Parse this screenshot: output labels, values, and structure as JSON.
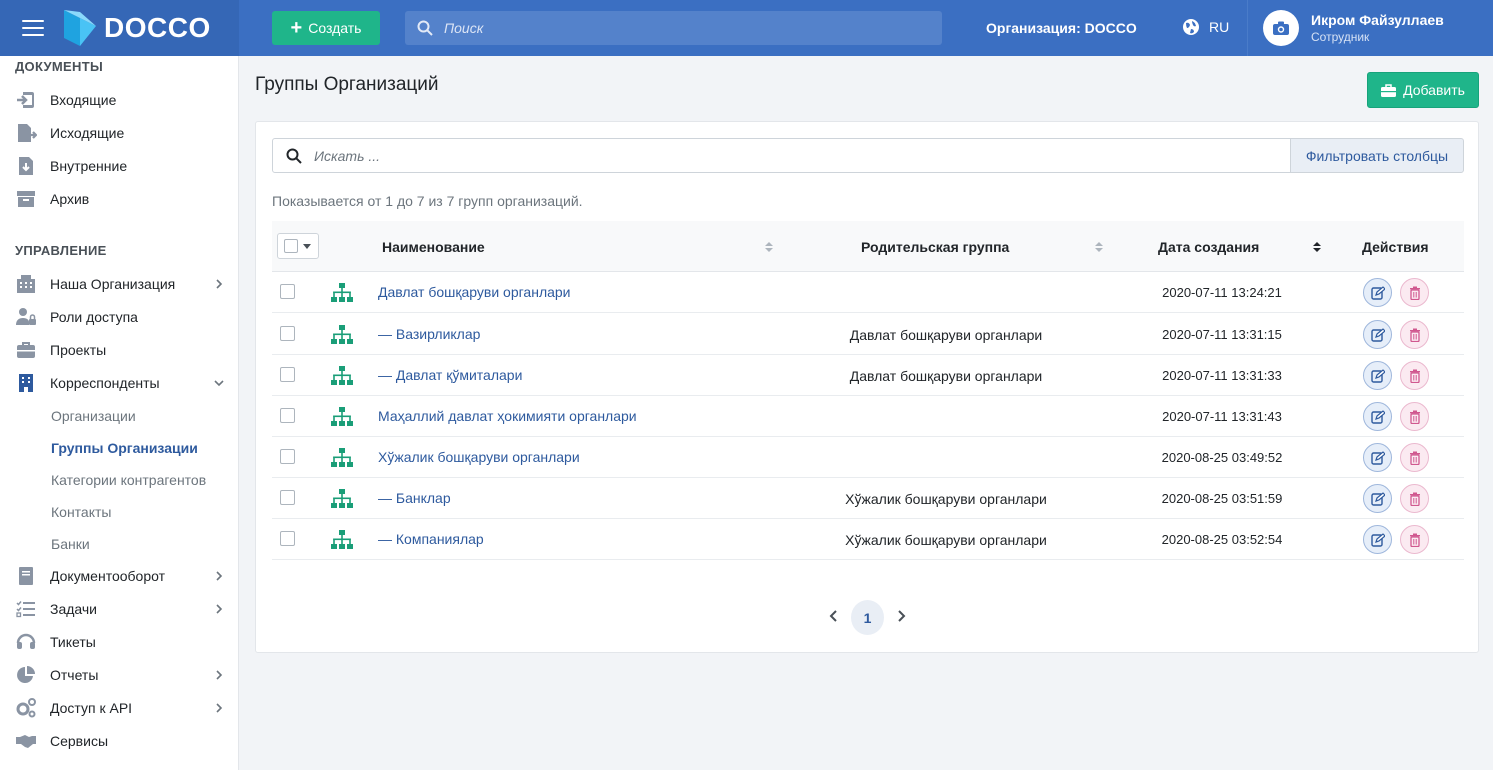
{
  "topbar": {
    "brand": "DOCCO",
    "create_label": "Создать",
    "search_placeholder": "Поиск",
    "org_label": "Организация: DOCCO",
    "lang": "RU",
    "user_name": "Икром Файзуллаев",
    "user_role": "Сотрудник"
  },
  "sidebar": {
    "section_docs": "ДОКУМЕНТЫ",
    "docs_items": [
      {
        "label": "Входящие",
        "icon": "inbox-in-icon"
      },
      {
        "label": "Исходящие",
        "icon": "file-out-icon"
      },
      {
        "label": "Внутренние",
        "icon": "file-download-icon"
      },
      {
        "label": "Архив",
        "icon": "archive-icon"
      }
    ],
    "section_manage": "УПРАВЛЕНИЕ",
    "manage_items": [
      {
        "label": "Наша Организация",
        "icon": "building-icon"
      },
      {
        "label": "Роли доступа",
        "icon": "users-lock-icon"
      },
      {
        "label": "Проекты",
        "icon": "briefcase-icon"
      },
      {
        "label": "Корреспонденты",
        "icon": "office-icon"
      }
    ],
    "sub_items": [
      "Организации",
      "Группы Организации",
      "Категории контрагентов",
      "Контакты",
      "Банки"
    ],
    "more_items": [
      {
        "label": "Документооборот",
        "icon": "book-icon"
      },
      {
        "label": "Задачи",
        "icon": "tasks-icon"
      },
      {
        "label": "Тикеты",
        "icon": "headset-icon"
      },
      {
        "label": "Отчеты",
        "icon": "pie-chart-icon"
      },
      {
        "label": "Доступ к API",
        "icon": "cogs-icon"
      },
      {
        "label": "Сервисы",
        "icon": "handshake-icon"
      }
    ]
  },
  "page": {
    "title": "Группы Организаций",
    "add_label": "Добавить",
    "search_placeholder": "Искать ...",
    "filter_label": "Фильтровать столбцы",
    "showing": "Показывается от 1 до 7 из 7 групп организаций."
  },
  "table": {
    "headers": {
      "name": "Наименование",
      "parent": "Родительская группа",
      "created": "Дата создания",
      "actions": "Действия"
    },
    "rows": [
      {
        "name": "Давлат бошқаруви органлари",
        "parent": "",
        "created": "2020-07-11 13:24:21"
      },
      {
        "name": "— Вазирликлар",
        "parent": "Давлат бошқаруви органлари",
        "created": "2020-07-11 13:31:15"
      },
      {
        "name": "— Давлат қўмиталари",
        "parent": "Давлат бошқаруви органлари",
        "created": "2020-07-11 13:31:33"
      },
      {
        "name": "Маҳаллий давлат ҳокимияти органлари",
        "parent": "",
        "created": "2020-07-11 13:31:43"
      },
      {
        "name": "Хўжалик бошқаруви органлари",
        "parent": "",
        "created": "2020-08-25 03:49:52"
      },
      {
        "name": "— Банклар",
        "parent": "Хўжалик бошқаруви органлари",
        "created": "2020-08-25 03:51:59"
      },
      {
        "name": "— Компаниялар",
        "parent": "Хўжалик бошқаруви органлари",
        "created": "2020-08-25 03:52:54"
      }
    ]
  },
  "pagination": {
    "current": "1"
  },
  "colors": {
    "primary": "#3b6fc2",
    "success": "#1fb58a",
    "link": "#2e5a9e",
    "tree_icon": "#1a9e78"
  }
}
